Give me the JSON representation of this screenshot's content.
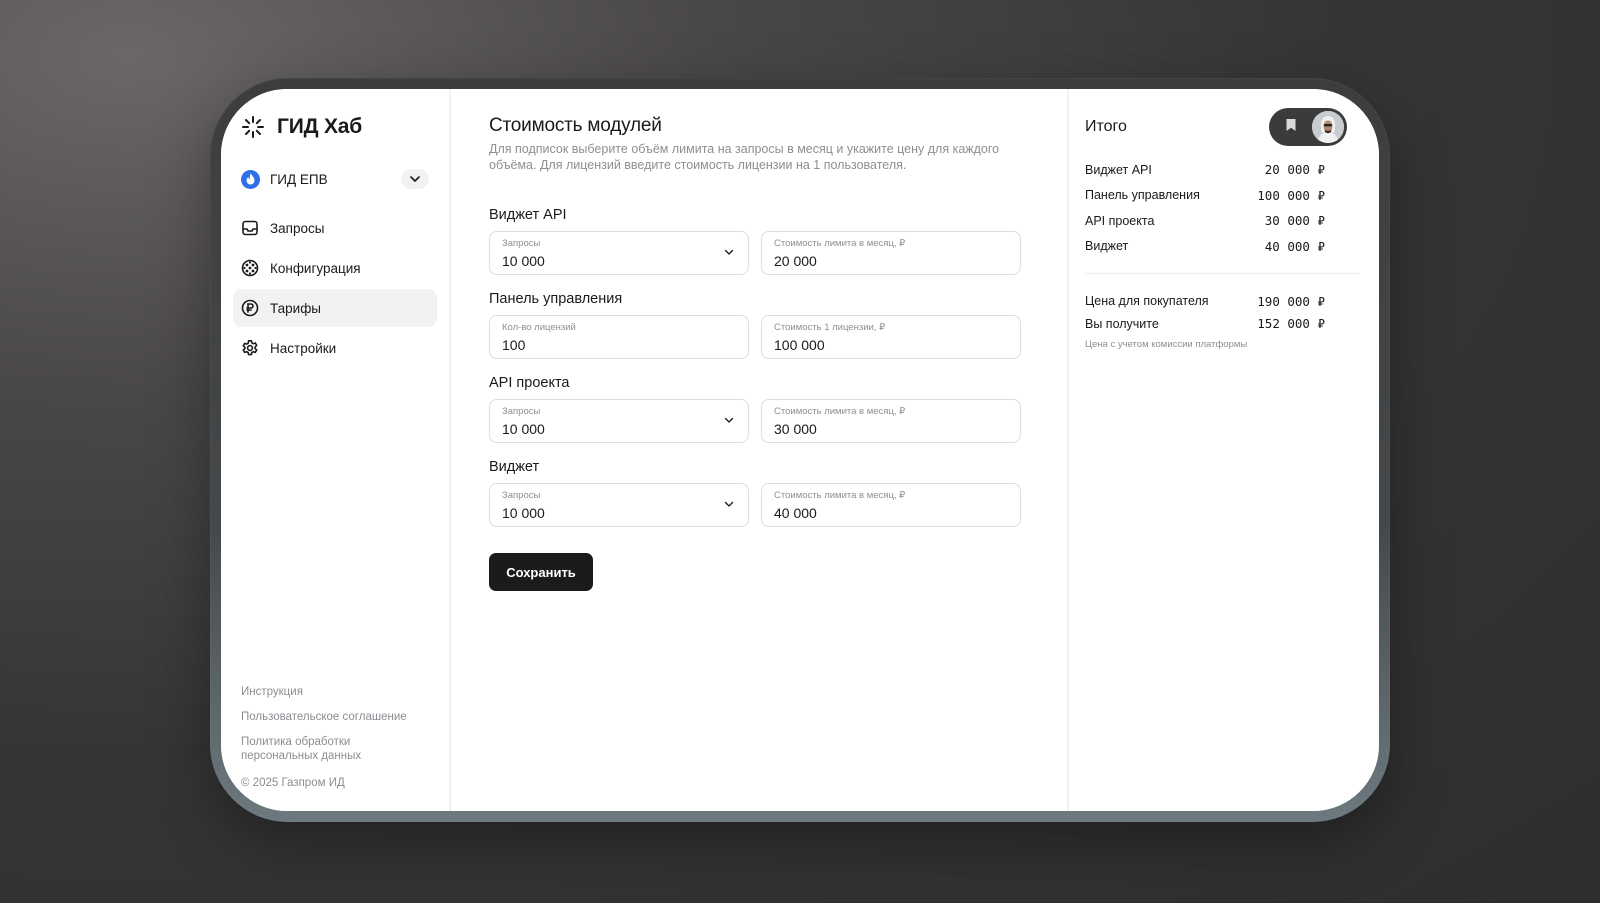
{
  "brand": {
    "name": "ГИД Хаб"
  },
  "workspace": {
    "name": "ГИД ЕПВ"
  },
  "nav": [
    {
      "label": "Запросы",
      "icon": "inbox-icon",
      "active": false
    },
    {
      "label": "Конфигурация",
      "icon": "globe-icon",
      "active": false
    },
    {
      "label": "Тарифы",
      "icon": "ruble-icon",
      "active": true
    },
    {
      "label": "Настройки",
      "icon": "gear-icon",
      "active": false
    }
  ],
  "footer": {
    "links": [
      "Инструкция",
      "Пользовательское соглашение",
      "Политика обработки персональных данных"
    ],
    "copyright": "© 2025 Газпром ИД"
  },
  "main": {
    "title": "Стоимость модулей",
    "description": "Для подписок выберите объём лимита на запросы в месяц и укажите цену для каждого объёма. Для лицензий введите стоимость лицензии на 1 пользователя.",
    "sections": [
      {
        "title": "Виджет API",
        "left": {
          "label": "Запросы",
          "value": "10 000",
          "dropdown": true
        },
        "right": {
          "label": "Стоимость лимита в месяц, ₽",
          "value": "20 000"
        }
      },
      {
        "title": "Панель управления",
        "left": {
          "label": "Кол-во лицензий",
          "value": "100",
          "dropdown": false
        },
        "right": {
          "label": "Стоимость 1 лицензии, ₽",
          "value": "100 000"
        }
      },
      {
        "title": "API проекта",
        "left": {
          "label": "Запросы",
          "value": "10 000",
          "dropdown": true
        },
        "right": {
          "label": "Стоимость лимита в месяц, ₽",
          "value": "30 000"
        }
      },
      {
        "title": "Виджет",
        "left": {
          "label": "Запросы",
          "value": "10 000",
          "dropdown": true
        },
        "right": {
          "label": "Стоимость лимита в месяц, ₽",
          "value": "40 000"
        }
      }
    ],
    "save_label": "Сохранить"
  },
  "summary": {
    "title": "Итого",
    "items": [
      {
        "label": "Виджет API",
        "value": "20 000 ₽"
      },
      {
        "label": "Панель управления",
        "value": "100 000 ₽"
      },
      {
        "label": "API проекта",
        "value": "30 000 ₽"
      },
      {
        "label": "Виджет",
        "value": "40 000 ₽"
      }
    ],
    "totals": [
      {
        "label": "Цена для покупателя",
        "value": "190 000 ₽"
      },
      {
        "label": "Вы получите",
        "value": "152 000 ₽"
      }
    ],
    "note": "Цена с учетом комиссии платформы"
  },
  "colors": {
    "accent": "#1b1b1c",
    "workspace_icon": "#2f6fe8",
    "muted_text": "#8c8f93"
  }
}
